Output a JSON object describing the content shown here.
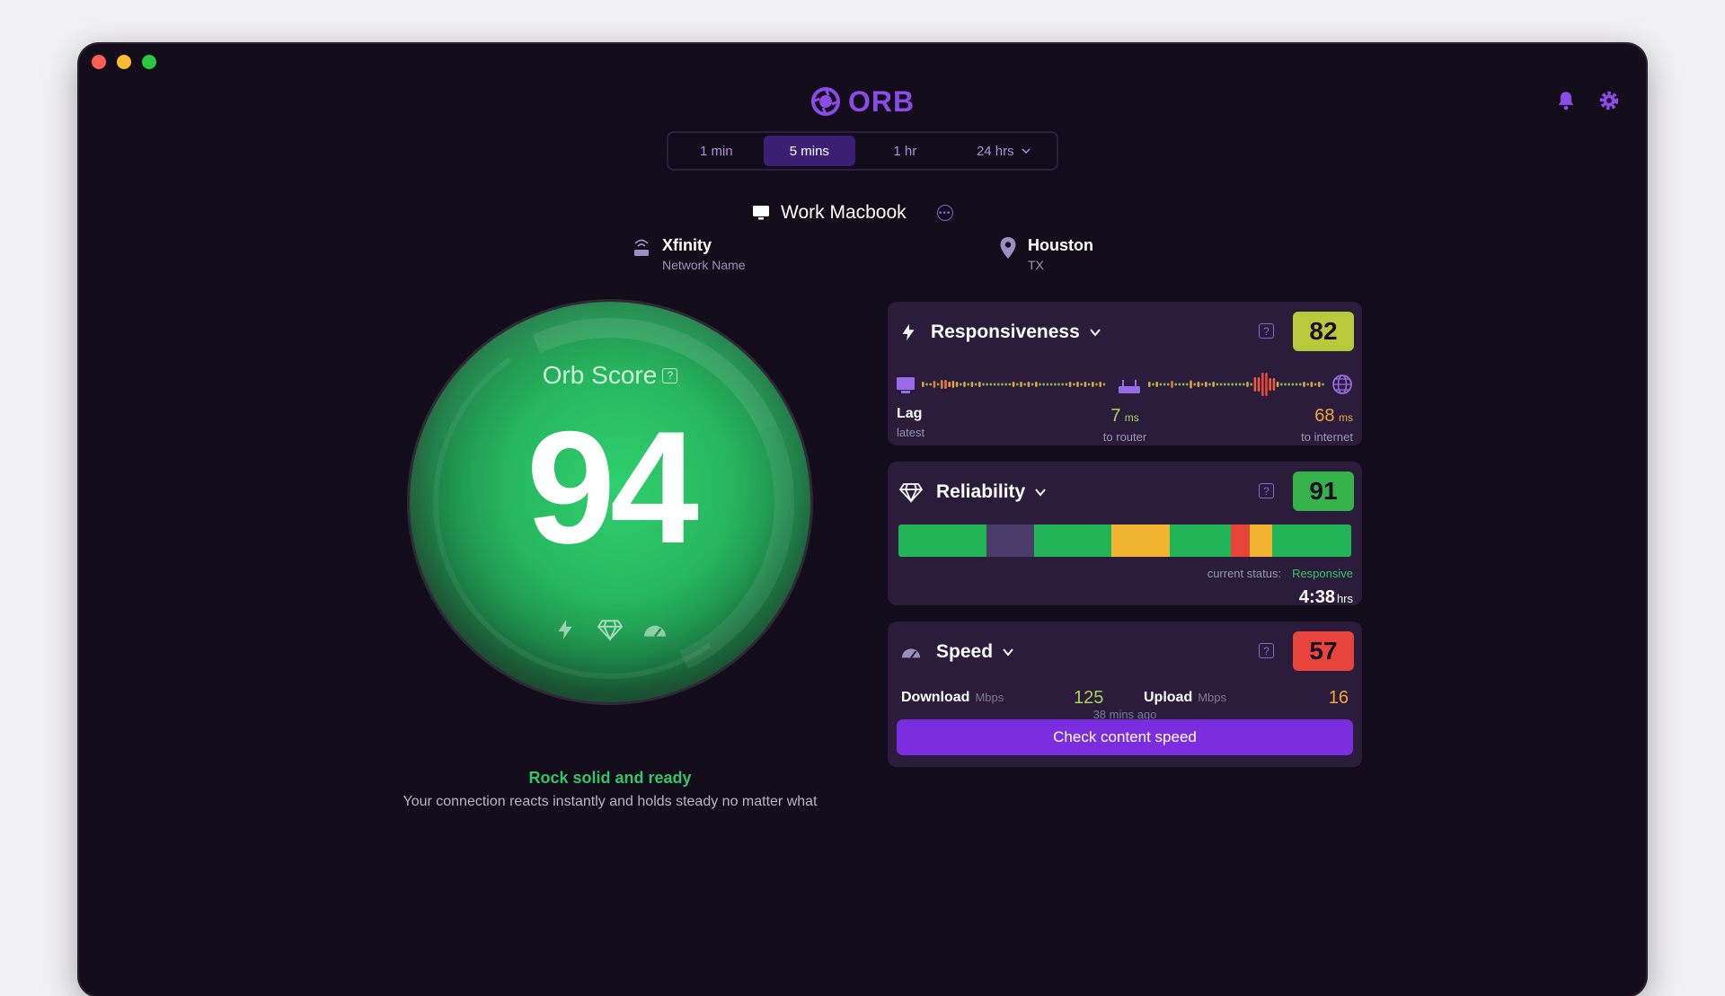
{
  "app": {
    "logo_text": "ORB",
    "brand_color": "#8b4be6"
  },
  "time_tabs": [
    {
      "label": "1 min",
      "active": false
    },
    {
      "label": "5 mins",
      "active": true
    },
    {
      "label": "1 hr",
      "active": false
    },
    {
      "label": "24 hrs",
      "active": false
    }
  ],
  "device": {
    "name": "Work Macbook",
    "icon": "monitor-icon"
  },
  "network": {
    "name": "Xfinity",
    "sub": "Network Name",
    "icon": "router-icon"
  },
  "location": {
    "city": "Houston",
    "region": "TX",
    "icon": "map-pin-icon"
  },
  "orb": {
    "title": "Orb Score",
    "score": "94",
    "icons": [
      "lightning-icon",
      "diamond-icon",
      "speedometer-icon"
    ],
    "headline": "Rock solid and ready",
    "description": "Your connection reacts instantly and holds steady no matter what"
  },
  "responsiveness": {
    "title": "Responsiveness",
    "score": "82",
    "badge_color": "#b9c93c",
    "lag_label": "Lag",
    "lag_sub": "latest",
    "router_value": "7",
    "router_unit": "ms",
    "router_sub": "to router",
    "internet_value": "68",
    "internet_unit": "ms",
    "internet_sub": "to internet"
  },
  "reliability": {
    "title": "Reliability",
    "score": "91",
    "badge_color": "#35b24a",
    "status_label": "current status:",
    "status_value": "Responsive",
    "duration": "4:38",
    "duration_unit": "hrs",
    "timeline": [
      {
        "status": "good",
        "fraction": 0.195,
        "color": "#22b457"
      },
      {
        "status": "unknown",
        "fraction": 0.105,
        "color": "#4a3b6b"
      },
      {
        "status": "good",
        "fraction": 0.17,
        "color": "#22b457"
      },
      {
        "status": "fair",
        "fraction": 0.13,
        "color": "#f2b531"
      },
      {
        "status": "good",
        "fraction": 0.135,
        "color": "#22b457"
      },
      {
        "status": "poor",
        "fraction": 0.04,
        "color": "#e8443c"
      },
      {
        "status": "fair",
        "fraction": 0.05,
        "color": "#f2b531"
      },
      {
        "status": "good",
        "fraction": 0.175,
        "color": "#22b457"
      }
    ]
  },
  "speed": {
    "title": "Speed",
    "score": "57",
    "badge_color": "#e8443c",
    "download_label": "Download",
    "download_unit": "Mbps",
    "download_value": "125",
    "upload_label": "Upload",
    "upload_unit": "Mbps",
    "upload_value": "16",
    "last_test": "38 mins ago",
    "button_label": "Check content speed"
  }
}
